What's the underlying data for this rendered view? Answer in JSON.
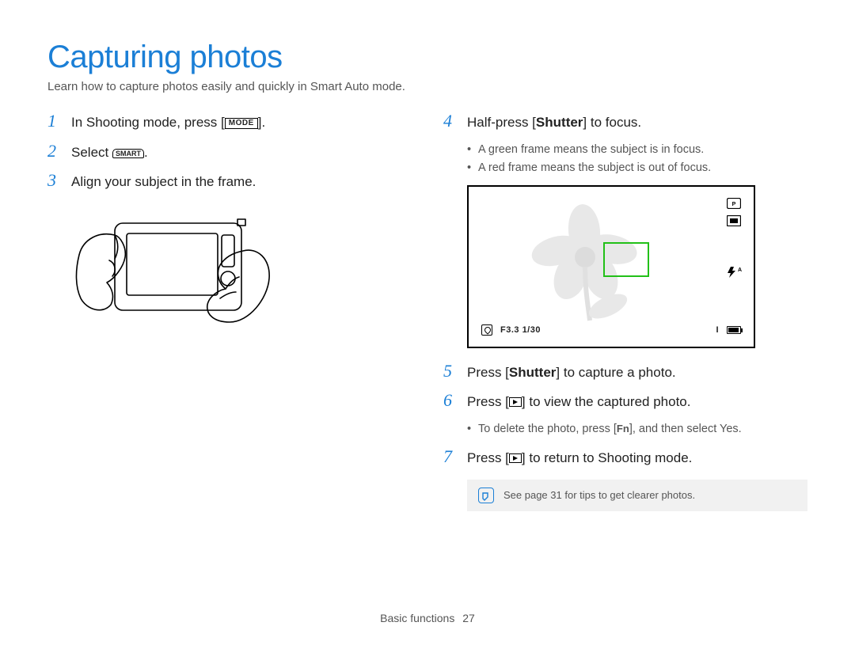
{
  "title": "Capturing photos",
  "subtitle": "Learn how to capture photos easily and quickly in Smart Auto mode.",
  "left": {
    "step1": {
      "num": "1",
      "pre": "In Shooting mode, press [",
      "btn": "MODE",
      "post": "]."
    },
    "step2": {
      "num": "2",
      "pre": "Select ",
      "icon_label": "SMART",
      "post": "."
    },
    "step3": {
      "num": "3",
      "text": "Align your subject in the frame."
    }
  },
  "right": {
    "step4": {
      "num": "4",
      "pre": "Half-press [",
      "bold": "Shutter",
      "post": "] to focus."
    },
    "step4_bullets": [
      "A green frame means the subject is in focus.",
      "A red frame means the subject is out of focus."
    ],
    "lcd": {
      "bottom_text": "F3.3  1/30",
      "scale_mark": "I"
    },
    "step5": {
      "num": "5",
      "pre": "Press [",
      "bold": "Shutter",
      "post": "] to capture a photo."
    },
    "step6": {
      "num": "6",
      "pre": "Press [",
      "post": "] to view the captured photo."
    },
    "step6_bullets_pre": "To delete the photo, press [",
    "step6_bullets_fn": "Fn",
    "step6_bullets_mid": "], and then select ",
    "step6_bullets_yes": "Yes",
    "step6_bullets_end": ".",
    "step7": {
      "num": "7",
      "pre": "Press [",
      "post": "] to return to Shooting mode."
    },
    "note": "See page 31 for tips to get clearer photos."
  },
  "footer": {
    "section": "Basic functions",
    "page": "27"
  }
}
